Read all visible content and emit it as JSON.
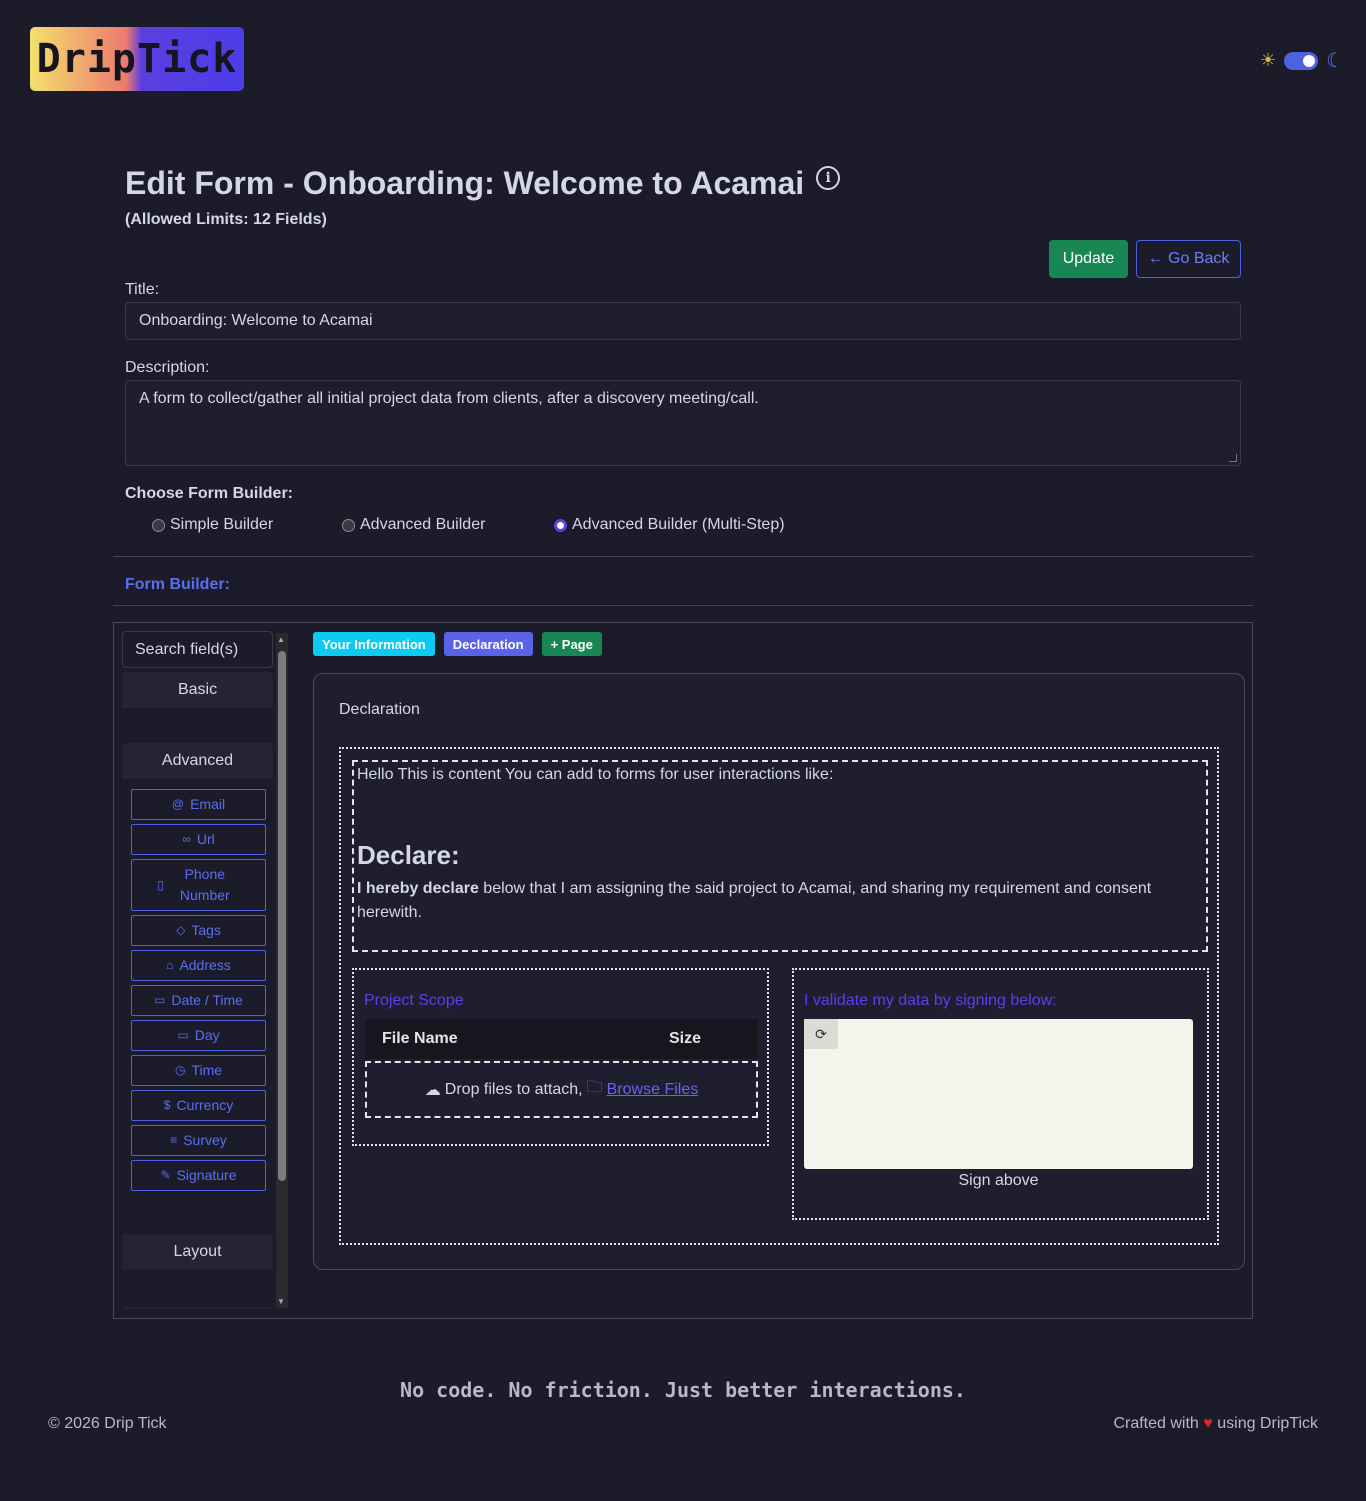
{
  "header": {
    "logo_text": "DripTick",
    "theme_sun_icon": "sun-icon",
    "theme_moon_icon": "moon-icon"
  },
  "page": {
    "title": "Edit Form - Onboarding: Welcome to Acamai",
    "limits": "(Allowed Limits: 12 Fields)",
    "update_label": "Update",
    "back_label": "← Go Back"
  },
  "form": {
    "title_label": "Title:",
    "title_value": "Onboarding: Welcome to Acamai",
    "description_label": "Description:",
    "description_value": "A form to collect/gather all initial project data from clients, after a discovery meeting/call.",
    "builder_label": "Choose Form Builder:",
    "builder_options": [
      "Simple Builder",
      "Advanced Builder",
      "Advanced Builder (Multi-Step)"
    ],
    "builder_selected": "Advanced Builder (Multi-Step)"
  },
  "builder": {
    "section_label": "Form Builder:",
    "search_placeholder": "Search field(s)",
    "sections": {
      "basic": "Basic",
      "advanced": "Advanced",
      "layout": "Layout"
    },
    "advanced_fields": [
      {
        "label": "Email",
        "icon": "@"
      },
      {
        "label": "Url",
        "icon": "∞"
      },
      {
        "label": "Phone Number",
        "icon": "▯"
      },
      {
        "label": "Tags",
        "icon": "◇"
      },
      {
        "label": "Address",
        "icon": "⌂"
      },
      {
        "label": "Date / Time",
        "icon": "▭"
      },
      {
        "label": "Day",
        "icon": "▭"
      },
      {
        "label": "Time",
        "icon": "◷"
      },
      {
        "label": "Currency",
        "icon": "$"
      },
      {
        "label": "Survey",
        "icon": "≡"
      },
      {
        "label": "Signature",
        "icon": "✎"
      }
    ],
    "tabs": [
      "Your Information",
      "Declaration",
      "+ Page"
    ],
    "card_title": "Declaration",
    "content": {
      "intro": "Hello This is content You can add to forms for user interactions like:",
      "heading": "Declare:",
      "body_bold": "I hereby declare",
      "body_rest": " below that I am assigning the said project to Acamai, and sharing my requirement and consent herewith."
    },
    "file_block": {
      "label": "Project Scope",
      "col_file_name": "File Name",
      "col_size": "Size",
      "drop_text": "Drop files to attach,",
      "browse_text": "Browse Files"
    },
    "signature_block": {
      "label": "I validate my data by signing below:",
      "caption": "Sign above"
    }
  },
  "footer": {
    "tagline": "No code. No friction. Just better interactions.",
    "copyright": "© 2026 Drip Tick",
    "crafted_prefix": "Crafted with",
    "crafted_suffix": "using DripTick"
  }
}
